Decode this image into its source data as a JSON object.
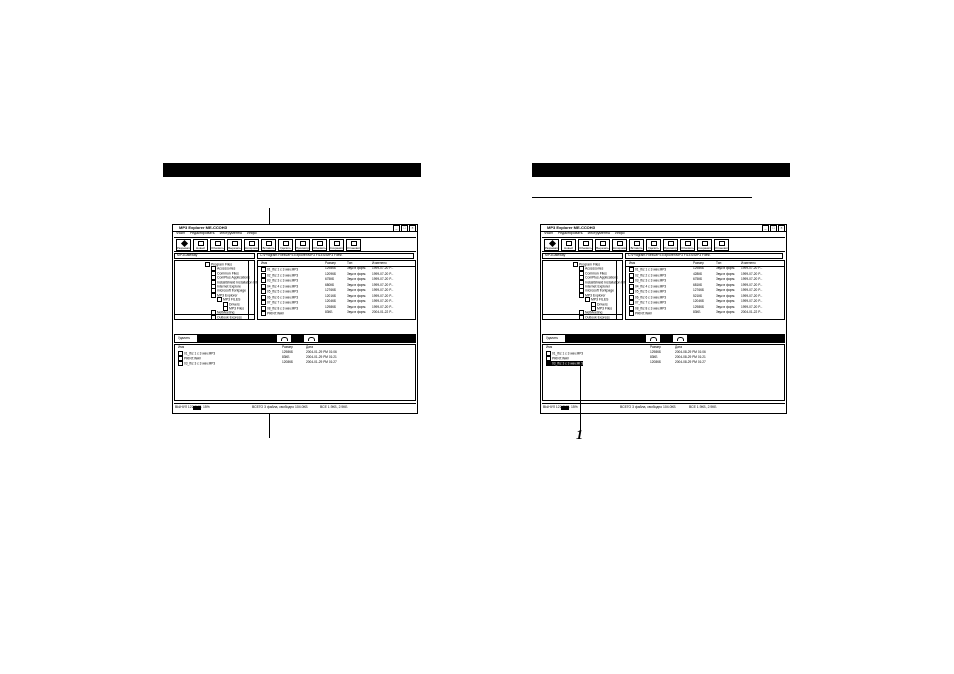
{
  "windows": [
    {
      "title": "MP3 Explorer МЕ-ССОНЗ",
      "menu": [
        "Файл",
        "Редактировать",
        "Инструменты",
        "Инфо"
      ],
      "toolbar": [
        "Разрывать",
        "Новый",
        "Обновить",
        "Вырезать",
        "Копировать",
        "Вставить",
        "Удалить",
        "Просмотр",
        "Обновить",
        "Сохранить",
        "Установить"
      ],
      "path_left": "MP3Gateway",
      "path_right": "C:\\Program Files\\MP3 Explorer\\MP3 FILES\\MP3 Files\\",
      "tree": [
        "Program Files",
        "Accessories",
        "Common Files",
        "ComPlus Applications",
        "InstallShield Installation Inf",
        "Internet Explore",
        "microsoft frontpage",
        "MP3 Explorer",
        "MP3 FILES",
        "Drivers",
        "MP3 Files",
        "NetMeeting",
        "Outlook Express"
      ],
      "file_headers": [
        "Имя",
        "Размер",
        "Тип",
        "Изменено"
      ],
      "files": [
        [
          "01_fbz 1 с 3 wav.MP3",
          "1298КБ",
          "Звук в форм.",
          "1999-07-20 Р..."
        ],
        [
          "02_fbz 2 с 3 wav.MP3",
          "1209КБ",
          "Звук в форм.",
          "1999-07-20 Р..."
        ],
        [
          "03_fbz 3 с 3 wav.MP3",
          "675КБ",
          "Звук в форм.",
          "1999-07-20 Р..."
        ],
        [
          "04_fbz 4 с 3 wav.MP3",
          "680КБ",
          "Звук в форм.",
          "1999-07-20 Р..."
        ],
        [
          "05_fbz 5 с 3 wav.MP3",
          "1276КБ",
          "Звук в форм.",
          "1999-07-20 Р..."
        ],
        [
          "06_fbz 6 с 3 wav.MP3",
          "1201КБ",
          "Звук в форм.",
          "1999-07-20 Р..."
        ],
        [
          "07_fbz 7 с 3 wav.MP3",
          "1204КБ",
          "Звук в форм.",
          "1999-07-20 Р..."
        ],
        [
          "08_fbz 8 с 3 wav.MP3",
          "1298КБ",
          "Звук в форм.",
          "1999-07-20 Р..."
        ],
        [
          "PRINT.WAV",
          "83КБ",
          "Звук в форм.",
          "2004-01-22 Р..."
        ]
      ],
      "lower_label": "Удалить",
      "lower_headers": [
        "Имя",
        "Размер",
        "Дата"
      ],
      "lower_files": [
        [
          "01_fbz 1 с 3 wav.MP3",
          "1298КБ",
          "2004-01-29 РМ 01:06"
        ],
        [
          "PRINT.WAV",
          "83КБ",
          "2004-01-29 РМ 01:21"
        ],
        [
          "03_fbz 3 с 3 wav.MP3",
          "1208КБ",
          "2004-01-29 РМ 01:27"
        ]
      ],
      "status": [
        "ВЫНУЛ 122.9МБ",
        "15%",
        "ВСЕГО 3 файла, свободно 104.0КБ",
        "ВСЕ 1.9КБ, 2.9КБ"
      ]
    },
    {
      "title": "MP3 Explorer МЕ-ССОНЗ",
      "menu": [
        "Файл",
        "Редактировать",
        "Инструменты",
        "Инфо"
      ],
      "toolbar": [
        "Разрывать",
        "Новый",
        "Обновить",
        "Вырезать",
        "Копировать",
        "Вставить",
        "Удалить",
        "Просмотр",
        "Обновить",
        "Сохранить",
        "Установить"
      ],
      "path_left": "MP3Gateway",
      "path_right": "C:\\Program Files\\MP3 Explorer\\MP3 FILES\\MP3 Files\\",
      "tree": [
        "Program Files",
        "Accessories",
        "Common Files",
        "ComPlus Applications",
        "InstallShield Installation Inf",
        "Internet Explorer",
        "microsoft frontpage",
        "MP3 Explorer",
        "MP3 FILES",
        "Drivers",
        "MP3 Files",
        "NetMeeting",
        "Outlook Express"
      ],
      "file_headers": [
        "Имя",
        "Размер",
        "Тип",
        "Изменено"
      ],
      "files": [
        [
          "01_fbz 1 с 3 wav.MP3",
          "1298КБ",
          "Звук в форм.",
          "1999-07-20 Р..."
        ],
        [
          "02_fbz 2 с 3 wav.MP3",
          "428КБ",
          "Звук в форм.",
          "1999-07-20 Р..."
        ],
        [
          "03_fbz 3 с 3 wav.MP3",
          "675КБ",
          "Звук в форм.",
          "1999-07-20 Р..."
        ],
        [
          "04_fbz 4 с 3 wav.MP3",
          "681КБ",
          "Звук в форм.",
          "1999-07-20 Р..."
        ],
        [
          "05_fbz 5 с 3 wav.MP3",
          "1276КБ",
          "Звук в форм.",
          "1999-07-20 Р..."
        ],
        [
          "06_fbz 6 с 3 wav.MP3",
          "521КБ",
          "Звук в форм.",
          "1999-07-20 Р..."
        ],
        [
          "07_fbz 7 с 3 wav.MP3",
          "1204КБ",
          "Звук в форм.",
          "1999-07-20 Р..."
        ],
        [
          "08_fbz 8 с 3 wav.MP3",
          "1298КБ",
          "Звук в форм.",
          "1999-07-20 Р..."
        ],
        [
          "PRINT.WAV",
          "83КБ",
          "Звук в форм.",
          "2004-01-22 Р..."
        ]
      ],
      "lower_label": "Удалить",
      "lower_headers": [
        "Имя",
        "Размер",
        "Дата"
      ],
      "lower_files": [
        [
          "01_fbz 1 с 3 wav.MP3",
          "1298КБ",
          "2004-08-29 РМ 01:06"
        ],
        [
          "PRINT.WAV",
          "83КБ",
          "2004-08-29 РМ 01:21"
        ],
        [
          "03_fbz 3 с 3 wav.MP3",
          "1208КБ",
          "2004-08-29 РМ 01:27"
        ]
      ],
      "status": [
        "ВЫНУЛ 122.9МБ",
        "15%",
        "ВСЕГО 3 файла, свободно 104.0КБ",
        "ВСЕ 1.9КБ, 2.9КБ"
      ]
    }
  ],
  "callout": {
    "number": "1"
  }
}
